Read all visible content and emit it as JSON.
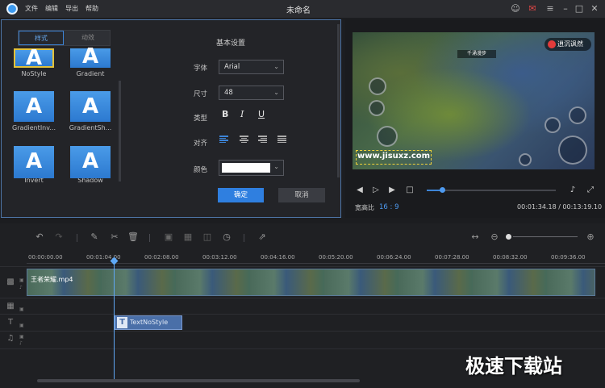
{
  "titlebar": {
    "menu": [
      "文件",
      "编辑",
      "导出",
      "帮助"
    ],
    "title": "未命名"
  },
  "style_panel": {
    "tabs": [
      "样式",
      "动效"
    ],
    "tiles": [
      {
        "glyph": "A",
        "label": "NoStyle",
        "selected": true
      },
      {
        "glyph": "A",
        "label": "Gradient"
      },
      {
        "glyph": "A",
        "label": "GradientInv..."
      },
      {
        "glyph": "A",
        "label": "GradientSh..."
      },
      {
        "glyph": "A",
        "label": "Invert"
      },
      {
        "glyph": "A",
        "label": "Shadow"
      }
    ],
    "section_title": "基本设置",
    "labels": {
      "font": "字体",
      "size": "尺寸",
      "type": "类型",
      "align": "对齐",
      "color": "颜色"
    },
    "font_value": "Arial",
    "size_value": "48",
    "format_buttons": [
      "B",
      "I",
      "U"
    ],
    "color_value": "#ffffff",
    "ok": "确定",
    "cancel": "取消"
  },
  "preview": {
    "watermark": "www.jisuxz.com",
    "badge": "逍沉讽然",
    "hud_text": "千涌漫步",
    "ratio_label": "宽高比",
    "ratio_value": "16 : 9",
    "timecode": "00:01:34.18 / 00:13:19.10",
    "progress": 0.12
  },
  "timeline": {
    "ticks": [
      "00:00:00.00",
      "00:01:04.00",
      "00:02:08.00",
      "00:03:12.00",
      "00:04:16.00",
      "00:05:20.00",
      "00:06:24.00",
      "00:07:28.00",
      "00:08:32.00",
      "00:09:36.00"
    ],
    "video_clip": "王者荣耀.mp4",
    "text_clip": "TextNoStyle"
  },
  "brand": "极速下载站",
  "colors": {
    "accent": "#3d84d6",
    "panel_border": "#4e76a8",
    "tile": "#2c79d0"
  }
}
